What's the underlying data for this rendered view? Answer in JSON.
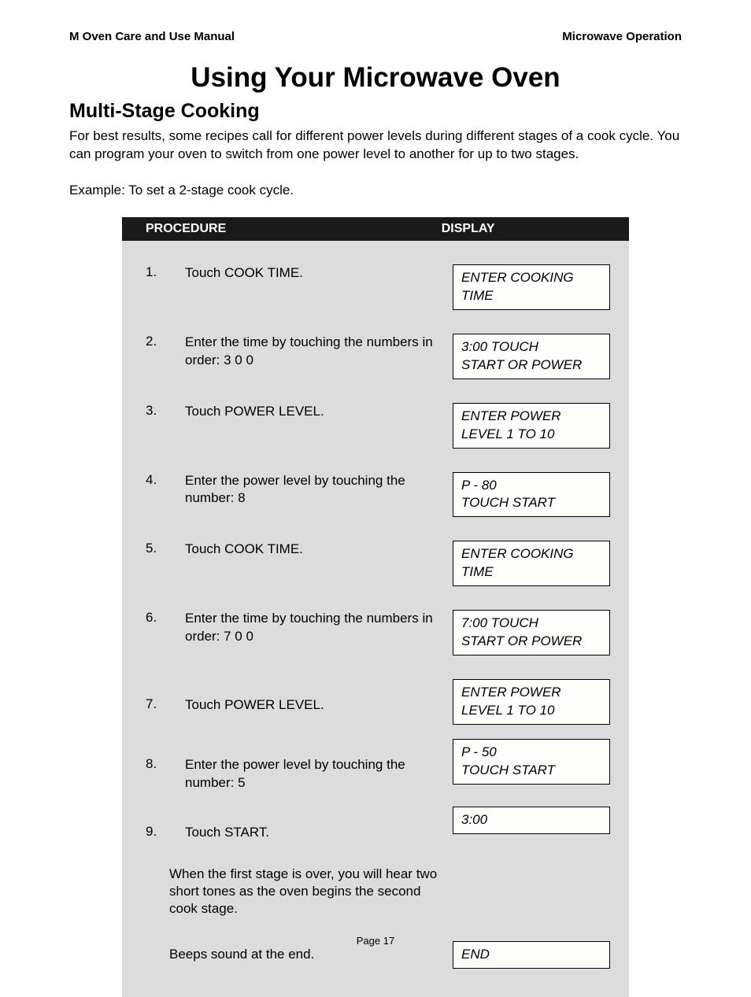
{
  "header": {
    "left": "M Oven Care and Use Manual",
    "right": "Microwave Operation"
  },
  "title": "Using Your Microwave Oven",
  "subtitle": "Multi-Stage Cooking",
  "intro": "For best results, some recipes call for different power levels during different stages of a cook cycle.   You can program your oven to switch from one power level to another for up to two stages.",
  "example": "Example: To set a 2-stage cook cycle.",
  "tableHeader": {
    "left": "PROCEDURE",
    "right": "DISPLAY"
  },
  "steps": [
    {
      "num": "1.",
      "text": "Touch COOK TIME.",
      "display": "ENTER COOKING TIME"
    },
    {
      "num": "2.",
      "text": "Enter the time by touching the numbers in order:  3   0   0",
      "display": "3:00  TOUCH\nSTART OR POWER"
    },
    {
      "num": "3.",
      "text": "Touch POWER LEVEL.",
      "display": "ENTER POWER\nLEVEL 1 TO 10"
    },
    {
      "num": "4.",
      "text": "Enter the power level by touching the number:  8",
      "display": "P - 80\nTOUCH START"
    },
    {
      "num": "5.",
      "text": "Touch COOK  TIME.",
      "display": "ENTER COOKING\nTIME"
    },
    {
      "num": "6.",
      "text": "Enter the time by touching the numbers in order:  7   0   0",
      "display": "7:00  TOUCH\nSTART OR POWER"
    },
    {
      "num": "7.",
      "text": "Touch POWER LEVEL.",
      "display": "ENTER POWER\nLEVEL 1 TO 10"
    },
    {
      "num": "8.",
      "text": "Enter the power level by touching the number:  5",
      "display": "P - 50\nTOUCH START"
    },
    {
      "num": "9.",
      "text": "Touch START.",
      "display": "3:00"
    }
  ],
  "note1": "When the first stage is over, you will hear two short tones as the oven begins the second cook stage.",
  "note2": "Beeps sound at the end.",
  "endDisplay": "END",
  "footer": "Page 17"
}
